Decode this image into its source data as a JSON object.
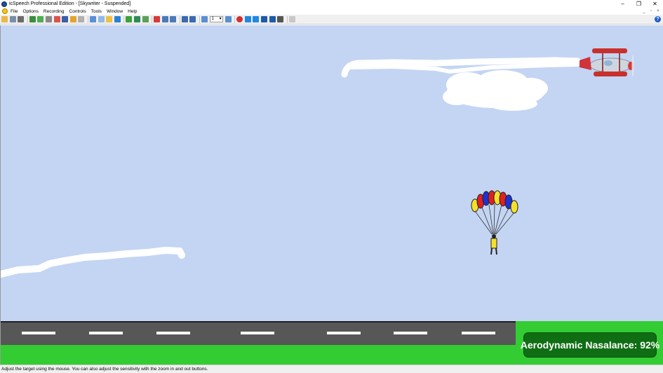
{
  "window": {
    "title": "icSpeech Professional Edition - [Skywriter - Suspended]",
    "controls": [
      "–",
      "❐",
      "✕"
    ],
    "mdi_controls": [
      "_",
      "▫",
      "×"
    ]
  },
  "menu": {
    "items": [
      "File",
      "Options",
      "Recording",
      "Controls",
      "Tools",
      "Window",
      "Help"
    ]
  },
  "toolbar": {
    "zoom_value": "1",
    "help_label": "?"
  },
  "game": {
    "nasalance_label": "Aerodynamic Nasalance: 92%",
    "colors": {
      "sky": "#c3d5f3",
      "grass": "#33cc33",
      "road": "#575757",
      "badge": "#0f6e14",
      "smoke": "#ffffff"
    }
  },
  "status": {
    "text": "Adjust the target using the mouse. You can also adjust the sensitivity with the zoom in and out buttons."
  }
}
